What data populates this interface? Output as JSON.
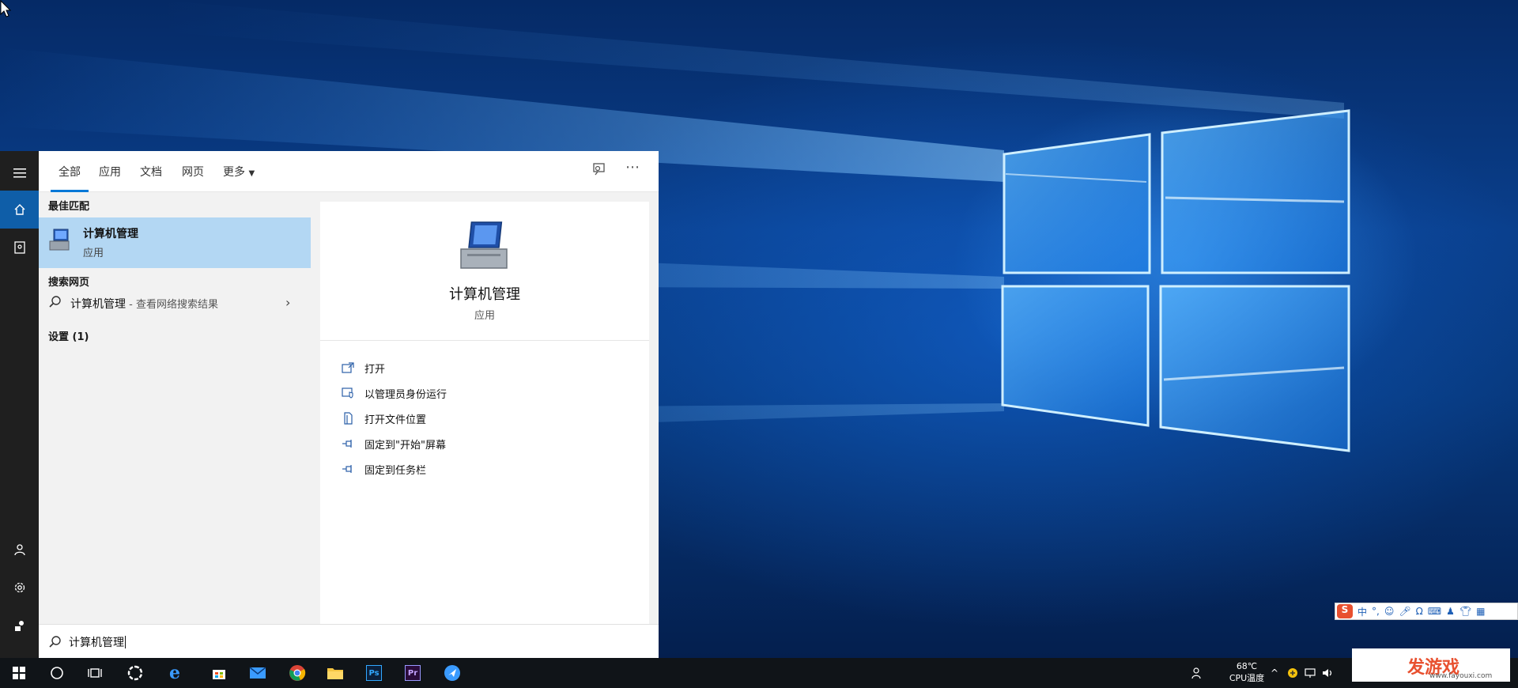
{
  "desktop": {
    "wallpaper": "windows-10-light-window",
    "accent": "#0078d7"
  },
  "rail": {
    "items": [
      {
        "name": "hamburger-menu-icon"
      },
      {
        "name": "home-icon",
        "active": true
      },
      {
        "name": "notebook-icon"
      },
      {
        "name": "account-icon"
      },
      {
        "name": "settings-icon"
      },
      {
        "name": "feedback-icon"
      }
    ]
  },
  "tabs": {
    "all": "全部",
    "apps": "应用",
    "docs": "文档",
    "web": "网页",
    "more": "更多"
  },
  "results": {
    "best_match_header": "最佳匹配",
    "best_match": {
      "title": "计算机管理",
      "subtitle": "应用"
    },
    "web_header": "搜索网页",
    "web_item": {
      "query": "计算机管理",
      "hint": " - 查看网络搜索结果"
    },
    "settings_header": "设置 (1)"
  },
  "detail": {
    "name": "计算机管理",
    "type": "应用",
    "actions": [
      {
        "label": "打开",
        "icon": "open-icon"
      },
      {
        "label": "以管理员身份运行",
        "icon": "shield-icon"
      },
      {
        "label": "打开文件位置",
        "icon": "file-location-icon"
      },
      {
        "label": "固定到\"开始\"屏幕",
        "icon": "pin-icon"
      },
      {
        "label": "固定到任务栏",
        "icon": "pin-icon"
      }
    ]
  },
  "search": {
    "value": "计算机管理"
  },
  "ime": {
    "lang": "中",
    "punct": "°,"
  },
  "tray": {
    "temp": "68℃",
    "temp_label": "CPU温度"
  },
  "watermark": {
    "brand": "发游戏",
    "url": "www.fayouxi.com"
  }
}
